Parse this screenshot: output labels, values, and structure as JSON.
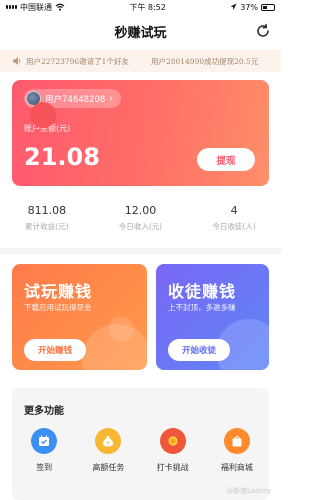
{
  "status_bar": {
    "carrier": "中国联通",
    "time": "下午 8:52",
    "battery": "37%"
  },
  "nav": {
    "title": "秒赚试玩"
  },
  "notices": [
    "用户22723796邀请了1个好友",
    "用户28014990成功提现20.5元"
  ],
  "account": {
    "user_label": "用户74648208",
    "balance_label": "账户余额(元)",
    "balance": "21.08",
    "withdraw_label": "提现"
  },
  "stats": [
    {
      "value": "811.08",
      "label": "累计收益(元)"
    },
    {
      "value": "12.00",
      "label": "今日收入(元)"
    },
    {
      "value": "4",
      "label": "今日收徒(人)"
    }
  ],
  "task_cards": {
    "trial": {
      "title": "试玩赚钱",
      "subtitle": "下载应用试玩得现金",
      "button": "开始赚钱"
    },
    "recruit": {
      "title": "收徒赚钱",
      "subtitle": "上不封顶，多邀多赚",
      "button": "开始收徒"
    }
  },
  "more": {
    "title": "更多功能",
    "items": [
      {
        "label": "签到",
        "icon": "calendar-check-icon",
        "color": "#3b8ff5"
      },
      {
        "label": "高额任务",
        "icon": "money-bag-icon",
        "color": "#f7b733"
      },
      {
        "label": "打卡挑战",
        "icon": "medal-icon",
        "color": "#f0573a"
      },
      {
        "label": "福利商城",
        "icon": "shopping-bag-icon",
        "color": "#ff8a2b"
      }
    ]
  },
  "watermark": "@新浪Ladery",
  "colors": {
    "balance_gradient_start": "#ff5a6f",
    "balance_gradient_end": "#ff8f6a",
    "trial_card": "#ff7b4a",
    "recruit_card": "#6b74f6",
    "notice_bg": "#fbf3ec"
  }
}
